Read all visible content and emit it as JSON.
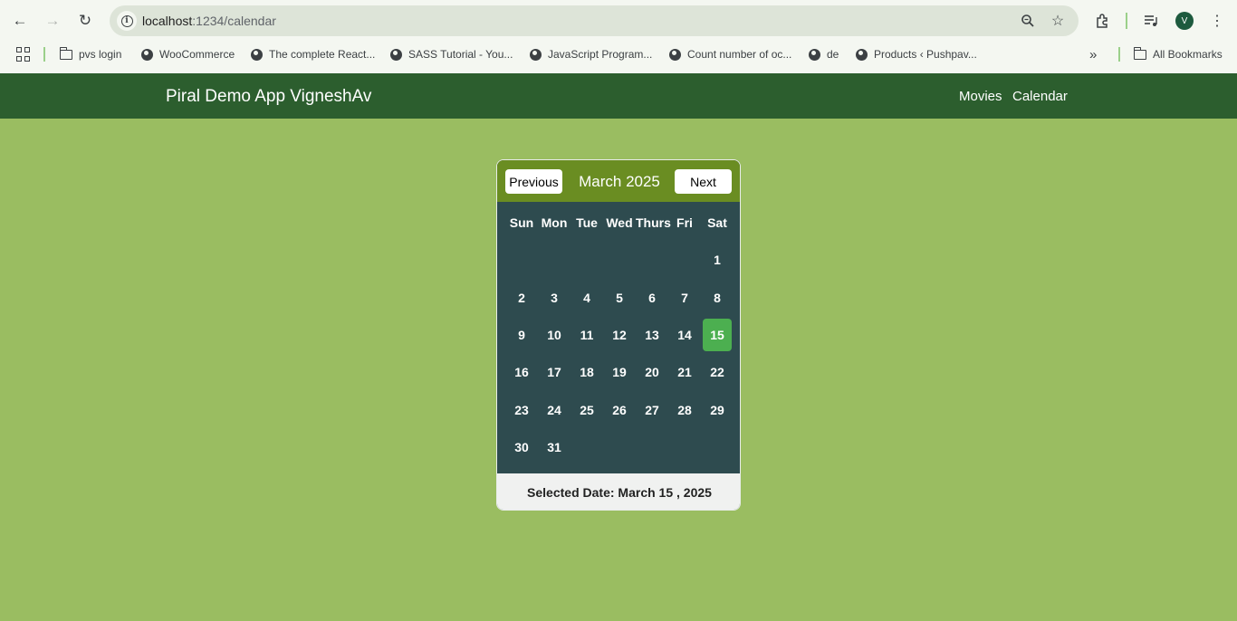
{
  "browser": {
    "url_host": "localhost",
    "url_path": ":1234/calendar",
    "avatar_letter": "V",
    "bookmarks": [
      {
        "label": "pvs login",
        "icon": "folder-icon"
      },
      {
        "label": "WooCommerce",
        "icon": "globe-icon"
      },
      {
        "label": "The complete React...",
        "icon": "globe-icon"
      },
      {
        "label": "SASS Tutorial - You...",
        "icon": "globe-icon"
      },
      {
        "label": "JavaScript Program...",
        "icon": "globe-icon"
      },
      {
        "label": "Count number of oc...",
        "icon": "globe-icon"
      },
      {
        "label": "de",
        "icon": "globe-icon"
      },
      {
        "label": "Products ‹ Pushpav...",
        "icon": "globe-icon"
      }
    ],
    "all_bookmarks": "All Bookmarks"
  },
  "app": {
    "brand": "Piral Demo App VigneshAv",
    "nav": [
      "Movies",
      "Calendar"
    ]
  },
  "calendar": {
    "prev_label": "Previous",
    "next_label": "Next",
    "month_title": "March 2025",
    "weekdays": [
      "Sun",
      "Mon",
      "Tue",
      "Wed",
      "Thurs",
      "Fri",
      "Sat"
    ],
    "first_weekday_index": 6,
    "days_in_month": 31,
    "selected_day": 15,
    "selected_text": "Selected Date: March 15 , 2025"
  },
  "colors": {
    "page_bg": "#9abd61",
    "header_bg": "#2c5e2e",
    "calendar_head": "#6a8d22",
    "calendar_body": "#2e4b4f",
    "selected_day": "#4caf50"
  }
}
